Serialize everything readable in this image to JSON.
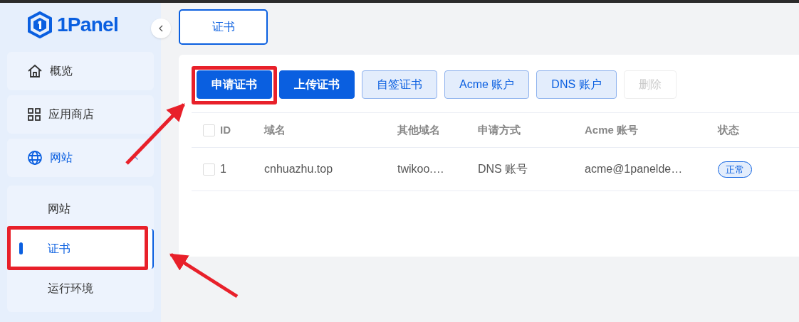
{
  "logo": {
    "text": "1Panel"
  },
  "sidebar": {
    "items": [
      {
        "label": "概览",
        "selected": false
      },
      {
        "label": "应用商店",
        "selected": false
      },
      {
        "label": "网站",
        "selected": false,
        "expanded": true,
        "children": [
          {
            "label": "网站",
            "selected": false
          },
          {
            "label": "证书",
            "selected": true
          },
          {
            "label": "运行环境",
            "selected": false
          }
        ]
      }
    ]
  },
  "tabs": [
    {
      "label": "证书",
      "selected": true
    }
  ],
  "toolbar": [
    {
      "label": "申请证书",
      "kind": "primary",
      "disabled": false,
      "highlighted": true
    },
    {
      "label": "上传证书",
      "kind": "primary",
      "disabled": false,
      "highlighted": false
    },
    {
      "label": "自签证书",
      "kind": "plain",
      "disabled": false,
      "highlighted": false
    },
    {
      "label": "Acme 账户",
      "kind": "plain",
      "disabled": false,
      "highlighted": false
    },
    {
      "label": "DNS 账户",
      "kind": "plain",
      "disabled": false,
      "highlighted": false
    },
    {
      "label": "删除",
      "kind": "default",
      "disabled": true,
      "highlighted": false
    }
  ],
  "table": {
    "header_checked": false,
    "columns": [
      "ID",
      "域名",
      "其他域名",
      "申请方式",
      "Acme 账号",
      "状态"
    ],
    "rows": [
      {
        "checked": false,
        "cells": [
          "1",
          "cnhuazhu.top",
          "twikoo.…",
          "DNS 账号",
          "acme@1panelde…"
        ],
        "status": "正常"
      }
    ]
  }
}
